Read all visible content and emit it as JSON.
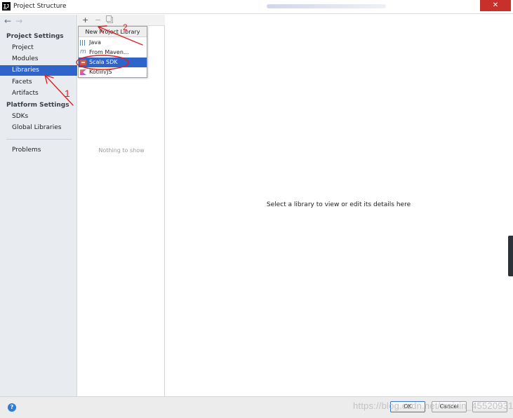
{
  "window": {
    "title": "Project Structure",
    "icon_text": "IJ",
    "close_glyph": "✕"
  },
  "nav": {
    "back_glyph": "←",
    "forward_glyph": "→",
    "project_settings_header": "Project Settings",
    "project_items": [
      {
        "label": "Project"
      },
      {
        "label": "Modules"
      },
      {
        "label": "Libraries",
        "selected": true
      },
      {
        "label": "Facets"
      },
      {
        "label": "Artifacts"
      }
    ],
    "platform_settings_header": "Platform Settings",
    "platform_items": [
      {
        "label": "SDKs"
      },
      {
        "label": "Global Libraries"
      }
    ],
    "problems_label": "Problems"
  },
  "library_list": {
    "add_glyph": "+",
    "remove_glyph": "−",
    "empty_text": "Nothing to show"
  },
  "popup": {
    "header": "New Project Library",
    "items": [
      {
        "label": "Java",
        "icon": "java-library-icon"
      },
      {
        "label": "From Maven...",
        "icon": "maven-icon"
      },
      {
        "label": "Scala SDK",
        "icon": "scala-sdk-icon",
        "selected": true
      },
      {
        "label": "Kotlin/JS",
        "icon": "kotlin-icon"
      }
    ]
  },
  "details": {
    "placeholder": "Select a library to view or edit its details here"
  },
  "footer": {
    "help_glyph": "?",
    "ok_label": "OK",
    "cancel_label": "Cancel",
    "watermark": "https://blog.csdn.net/weixin_45520931"
  },
  "annotations": {
    "step1": "1",
    "step2": "2",
    "color": "#e02020"
  },
  "colors": {
    "selection": "#2f65ca",
    "nav_background": "#e8ebf0",
    "close_button": "#c7302b"
  }
}
